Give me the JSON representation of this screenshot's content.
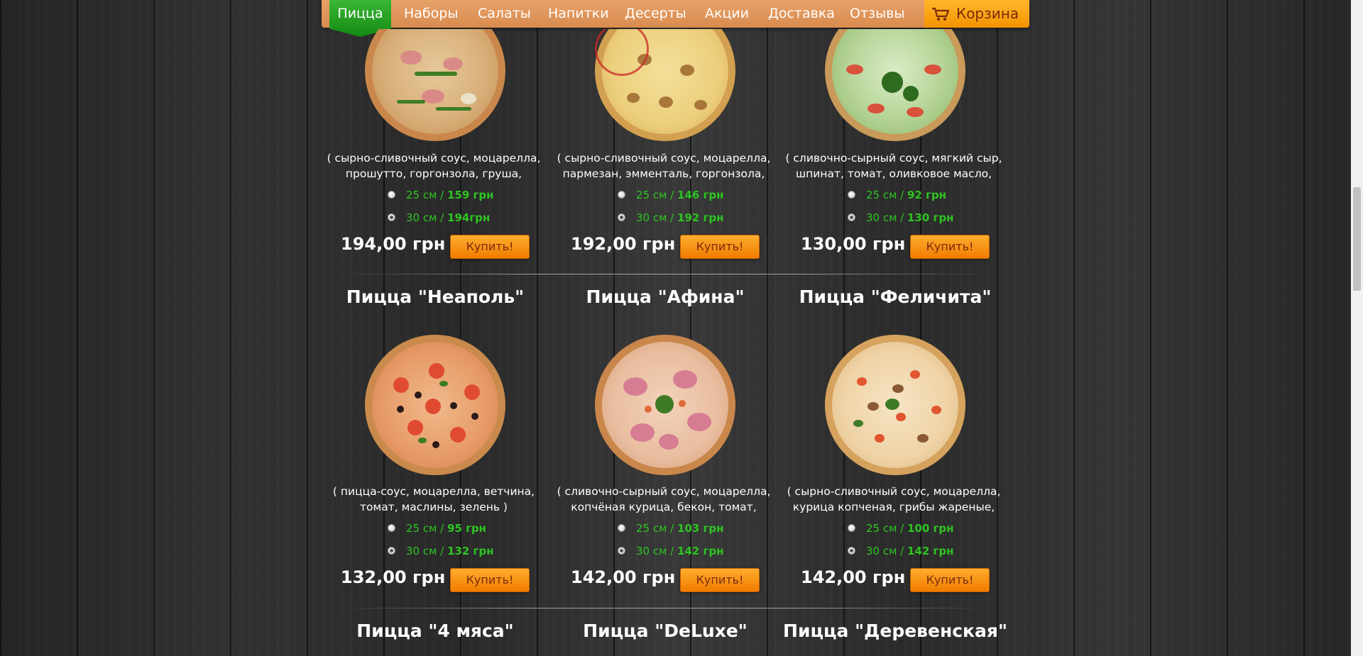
{
  "nav": {
    "active_item": "Пицца",
    "items": [
      "Наборы",
      "Салаты",
      "Напитки",
      "Десерты",
      "Акции",
      "Доставка",
      "Отзывы"
    ],
    "cart_label": "Корзина",
    "cart_icon": "shopping-cart-icon"
  },
  "colors": {
    "nav_bg": "#de9158",
    "nav_active": "#26a022",
    "buy_button": "#f89a14",
    "size_text": "#2ec422",
    "cart_text": "#7a2a0c"
  },
  "row1": [
    {
      "description": "( сырно-сливочный соус, моцарелла, прошутто, горгонзола, груша,",
      "size_small_label": "25 см / ",
      "size_small_price": "159 грн",
      "size_large_label": "30 см / ",
      "size_large_price": "194грн",
      "selected": "30",
      "price": "194,00 грн",
      "buy_label": "Купить!"
    },
    {
      "description": "( сырно-сливочный соус, моцарелла, пармезан, эмменталь, горгонзола,",
      "size_small_label": "25 см / ",
      "size_small_price": "146 грн",
      "size_large_label": "30 см / ",
      "size_large_price": "192 грн",
      "selected": "30",
      "price": "192,00 грн",
      "buy_label": "Купить!"
    },
    {
      "description": "( сливочно-сырный соус, мягкий сыр, шпинат, томат, оливковое масло,",
      "size_small_label": "25 см / ",
      "size_small_price": "92 грн",
      "size_large_label": "30 см / ",
      "size_large_price": "130 грн",
      "selected": "30",
      "price": "130,00 грн",
      "buy_label": "Купить!"
    }
  ],
  "row2": [
    {
      "title": "Пицца \"Неаполь\"",
      "description": "( пицца-соус, моцарелла, ветчина, томат, маслины, зелень )",
      "size_small_label": "25 см / ",
      "size_small_price": "95 грн",
      "size_large_label": "30 см / ",
      "size_large_price": "132 грн",
      "selected": "30",
      "price": "132,00 грн",
      "buy_label": "Купить!"
    },
    {
      "title": "Пицца \"Афина\"",
      "description": "( сливочно-сырный соус, моцарелла, копчёная курица, бекон, томат, зелень",
      "size_small_label": "25 см / ",
      "size_small_price": "103 грн",
      "size_large_label": "30 см / ",
      "size_large_price": "142 грн",
      "selected": "30",
      "price": "142,00 грн",
      "buy_label": "Купить!"
    },
    {
      "title": "Пицца \"Феличита\"",
      "description": "( сырно-сливочный соус, моцарелла, курица копченая, грибы жареные,",
      "size_small_label": "25 см / ",
      "size_small_price": "100 грн",
      "size_large_label": "30 см / ",
      "size_large_price": "142 грн",
      "selected": "30",
      "price": "142,00 грн",
      "buy_label": "Купить!"
    }
  ],
  "row3": [
    {
      "title": "Пицца \"4 мяса\""
    },
    {
      "title": "Пицца \"DeLuxe\""
    },
    {
      "title": "Пицца \"Деревенская\""
    }
  ]
}
